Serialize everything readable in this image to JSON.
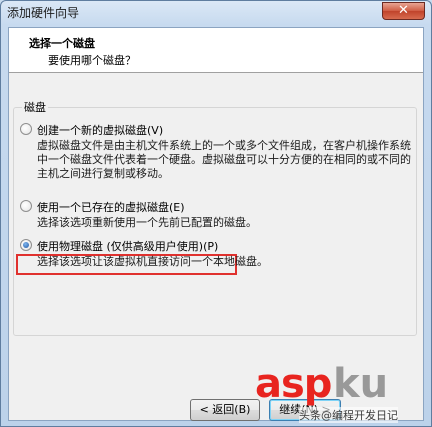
{
  "window": {
    "title": "添加硬件向导",
    "close_label": "✕"
  },
  "header": {
    "title": "选择一个磁盘",
    "subtitle": "要使用哪个磁盘？"
  },
  "group": {
    "label": "磁盘",
    "options": [
      {
        "label": "创建一个新的虚拟磁盘(V)",
        "checked": false,
        "description": "虚拟磁盘文件是由主机文件系统上的一个或多个文件组成，在客户机操作系统中一个磁盘文件代表着一个硬盘。虚拟磁盘可以十分方便的在相同的或不同的主机之间进行复制或移动。"
      },
      {
        "label": "使用一个已存在的虚拟磁盘(E)",
        "checked": false,
        "description": "选择该选项重新使用一个先前已配置的磁盘。"
      },
      {
        "label": "使用物理磁盘 (仅供高级用户使用)(P)",
        "checked": true,
        "description": "选择该选项让该虚拟机直接访问一个本地磁盘。"
      }
    ]
  },
  "buttons": {
    "back": "< 返回(B)",
    "next": "继续(N) >"
  },
  "watermark": {
    "asp": "asp",
    "ku": "ku",
    "text": "头条@编程开发日记"
  },
  "colors": {
    "highlight": "#e0312e",
    "radio_checked": "#1f57a3"
  }
}
